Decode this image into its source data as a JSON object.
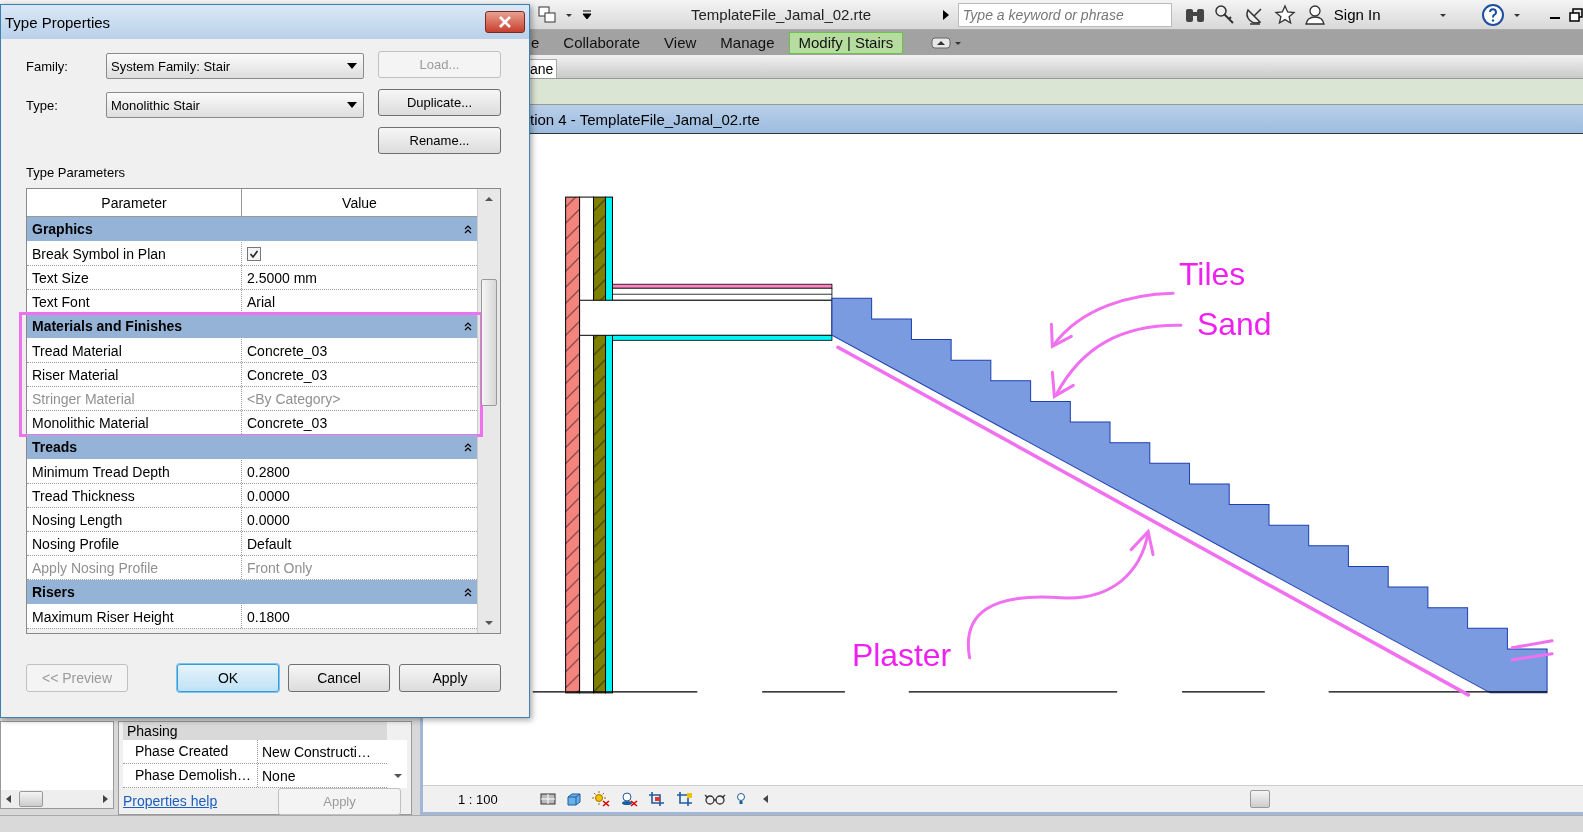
{
  "app": {
    "title": "TemplateFile_Jamal_02.rte",
    "search": {
      "placeholder": "Type a keyword or phrase"
    },
    "sign_in": "Sign In"
  },
  "ribbon_tabs": [
    {
      "label": "e",
      "selected": false
    },
    {
      "label": "Collaborate",
      "selected": false
    },
    {
      "label": "View",
      "selected": false
    },
    {
      "label": "Manage",
      "selected": false
    },
    {
      "label": "Modify | Stairs",
      "selected": true
    }
  ],
  "options_bar": {
    "tab": "ane"
  },
  "view": {
    "title": "tion 4 - TemplateFile_Jamal_02.rte",
    "annotations": [
      {
        "label": "Tiles"
      },
      {
        "label": "Sand"
      },
      {
        "label": "Plaster"
      }
    ],
    "scale": "1 : 100"
  },
  "properties": {
    "group": "Phasing",
    "rows": [
      {
        "name": "Phase Created",
        "value": "New Constructi…"
      },
      {
        "name": "Phase Demolish…",
        "value": "None"
      }
    ],
    "help_link": "Properties help",
    "apply": {
      "label": "Apply",
      "disabled": true
    }
  },
  "dialog": {
    "title": "Type Properties",
    "fields": [
      {
        "label": "Family:",
        "value": "System Family: Stair"
      },
      {
        "label": "Type:",
        "value": "Monolithic Stair"
      }
    ],
    "buttons": [
      {
        "label": "Load...",
        "disabled": true
      },
      {
        "label": "Duplicate...",
        "disabled": false
      },
      {
        "label": "Rename...",
        "disabled": false
      }
    ],
    "section_label": "Type Parameters",
    "columns": [
      "Parameter",
      "Value"
    ],
    "groups": [
      {
        "title": "Graphics",
        "expanded": true,
        "highlighted": false,
        "rows": [
          {
            "kind": "checkbox",
            "name": "Break Symbol in Plan",
            "checked": true,
            "disabled": false
          },
          {
            "kind": "text",
            "name": "Text Size",
            "value": "2.5000 mm",
            "disabled": false
          },
          {
            "kind": "text",
            "name": "Text Font",
            "value": "Arial",
            "disabled": false
          }
        ]
      },
      {
        "title": "Materials and Finishes",
        "expanded": true,
        "highlighted": true,
        "rows": [
          {
            "kind": "text",
            "name": "Tread Material",
            "value": "Concrete_03",
            "disabled": false
          },
          {
            "kind": "text",
            "name": "Riser Material",
            "value": "Concrete_03",
            "disabled": false
          },
          {
            "kind": "text",
            "name": "Stringer Material",
            "value": "<By Category>",
            "disabled": true
          },
          {
            "kind": "text",
            "name": "Monolithic Material",
            "value": "Concrete_03",
            "disabled": false
          }
        ]
      },
      {
        "title": "Treads",
        "expanded": true,
        "highlighted": false,
        "rows": [
          {
            "kind": "text",
            "name": "Minimum Tread Depth",
            "value": "0.2800",
            "disabled": false
          },
          {
            "kind": "text",
            "name": "Tread Thickness",
            "value": "0.0000",
            "disabled": false
          },
          {
            "kind": "text",
            "name": "Nosing Length",
            "value": "0.0000",
            "disabled": false
          },
          {
            "kind": "text",
            "name": "Nosing Profile",
            "value": "Default",
            "disabled": false
          },
          {
            "kind": "text",
            "name": "Apply Nosing Profile",
            "value": "Front Only",
            "disabled": true
          }
        ]
      },
      {
        "title": "Risers",
        "expanded": true,
        "highlighted": false,
        "rows": [
          {
            "kind": "text",
            "name": "Maximum Riser Height",
            "value": "0.1800",
            "disabled": false
          }
        ]
      }
    ],
    "footer_buttons": [
      {
        "label": "<< Preview",
        "disabled": true,
        "default": false
      },
      {
        "label": "OK",
        "disabled": false,
        "default": true
      },
      {
        "label": "Cancel",
        "disabled": false,
        "default": false
      },
      {
        "label": "Apply",
        "disabled": false,
        "default": false
      }
    ]
  }
}
